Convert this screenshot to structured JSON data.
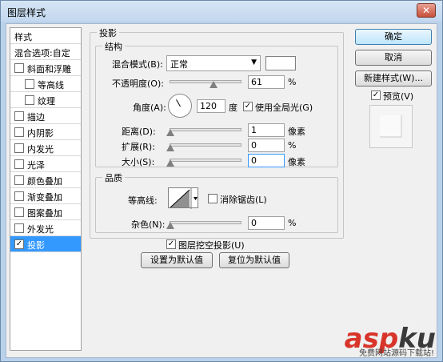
{
  "window": {
    "title": "图层样式",
    "close_glyph": "✕"
  },
  "sidebar": {
    "header": "样式",
    "blend_options": "混合选项:自定",
    "items": [
      {
        "label": "斜面和浮雕",
        "checked": false,
        "indent": false
      },
      {
        "label": "等高线",
        "checked": false,
        "indent": true
      },
      {
        "label": "纹理",
        "checked": false,
        "indent": true
      },
      {
        "label": "描边",
        "checked": false,
        "indent": false
      },
      {
        "label": "内阴影",
        "checked": false,
        "indent": false
      },
      {
        "label": "内发光",
        "checked": false,
        "indent": false
      },
      {
        "label": "光泽",
        "checked": false,
        "indent": false
      },
      {
        "label": "颜色叠加",
        "checked": false,
        "indent": false
      },
      {
        "label": "渐变叠加",
        "checked": false,
        "indent": false
      },
      {
        "label": "图案叠加",
        "checked": false,
        "indent": false
      },
      {
        "label": "外发光",
        "checked": false,
        "indent": false
      },
      {
        "label": "投影",
        "checked": true,
        "indent": false
      }
    ]
  },
  "shadow": {
    "group_title": "投影",
    "structure_title": "结构",
    "blend_mode_label": "混合模式(B):",
    "blend_mode_value": "正常",
    "opacity_label": "不透明度(O):",
    "opacity_value": "61",
    "opacity_percent": 61,
    "angle_label": "角度(A):",
    "angle_value": "120",
    "angle_unit": "度",
    "use_global_light_label": "使用全局光(G)",
    "use_global_light": true,
    "distance_label": "距离(D):",
    "distance_value": "1",
    "distance_unit": "像素",
    "spread_label": "扩展(R):",
    "spread_value": "0",
    "spread_unit": "%",
    "size_label": "大小(S):",
    "size_value": "0",
    "size_unit": "像素",
    "percent_unit": "%"
  },
  "quality": {
    "group_title": "品质",
    "contour_label": "等高线:",
    "anti_alias_label": "消除锯齿(L)",
    "anti_alias": false,
    "noise_label": "杂色(N):",
    "noise_value": "0",
    "noise_unit": "%"
  },
  "footer": {
    "knockout_label": "图层挖空投影(U)",
    "knockout": true,
    "set_default": "设置为默认值",
    "reset_default": "复位为默认值"
  },
  "right_panel": {
    "ok": "确定",
    "cancel": "取消",
    "new_style": "新建样式(W)...",
    "preview_label": "预览(V)",
    "preview": true
  },
  "watermark": {
    "main_a": "asp",
    "main_b": "ku",
    "sub": "免费网站源码下载站!"
  }
}
